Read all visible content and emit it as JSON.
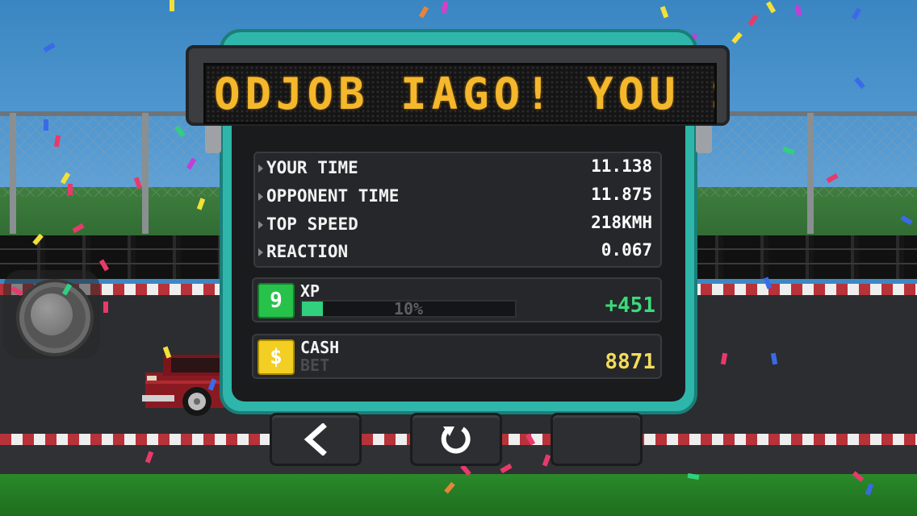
{
  "banner": {
    "scroll_text": "ODJOB IAGO! YOU SE"
  },
  "results": {
    "rows": [
      {
        "label": "YOUR TIME",
        "value": "11.138"
      },
      {
        "label": "OPPONENT TIME",
        "value": "11.875"
      },
      {
        "label": "TOP SPEED",
        "value": "218KMH"
      },
      {
        "label": "REACTION",
        "value": "0.067"
      }
    ]
  },
  "xp": {
    "level": "9",
    "label": "XP",
    "progress_text": "10%",
    "progress": 0.1,
    "gain": "+451"
  },
  "cash": {
    "icon_text": "$",
    "label": "CASH",
    "bet_label": "BET",
    "amount": "8871"
  },
  "buttons": {
    "back_icon": "chevron-left-icon",
    "retry_icon": "restart-icon"
  },
  "colors": {
    "board_teal": "#2fb6ab",
    "led_amber": "#f5b82c",
    "xp_green": "#30d07e",
    "cash_yellow": "#f2cf22"
  }
}
